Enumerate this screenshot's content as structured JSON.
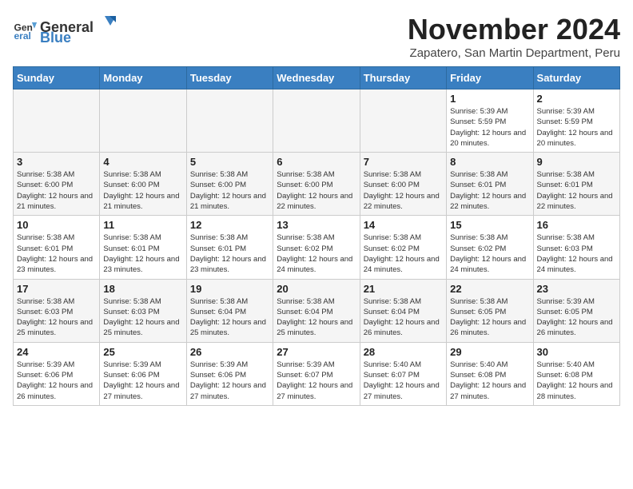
{
  "header": {
    "logo_general": "General",
    "logo_blue": "Blue",
    "month": "November 2024",
    "location": "Zapatero, San Martin Department, Peru"
  },
  "days_of_week": [
    "Sunday",
    "Monday",
    "Tuesday",
    "Wednesday",
    "Thursday",
    "Friday",
    "Saturday"
  ],
  "weeks": [
    [
      {
        "day": "",
        "info": ""
      },
      {
        "day": "",
        "info": ""
      },
      {
        "day": "",
        "info": ""
      },
      {
        "day": "",
        "info": ""
      },
      {
        "day": "",
        "info": ""
      },
      {
        "day": "1",
        "info": "Sunrise: 5:39 AM\nSunset: 5:59 PM\nDaylight: 12 hours and 20 minutes."
      },
      {
        "day": "2",
        "info": "Sunrise: 5:39 AM\nSunset: 5:59 PM\nDaylight: 12 hours and 20 minutes."
      }
    ],
    [
      {
        "day": "3",
        "info": "Sunrise: 5:38 AM\nSunset: 6:00 PM\nDaylight: 12 hours and 21 minutes."
      },
      {
        "day": "4",
        "info": "Sunrise: 5:38 AM\nSunset: 6:00 PM\nDaylight: 12 hours and 21 minutes."
      },
      {
        "day": "5",
        "info": "Sunrise: 5:38 AM\nSunset: 6:00 PM\nDaylight: 12 hours and 21 minutes."
      },
      {
        "day": "6",
        "info": "Sunrise: 5:38 AM\nSunset: 6:00 PM\nDaylight: 12 hours and 22 minutes."
      },
      {
        "day": "7",
        "info": "Sunrise: 5:38 AM\nSunset: 6:00 PM\nDaylight: 12 hours and 22 minutes."
      },
      {
        "day": "8",
        "info": "Sunrise: 5:38 AM\nSunset: 6:01 PM\nDaylight: 12 hours and 22 minutes."
      },
      {
        "day": "9",
        "info": "Sunrise: 5:38 AM\nSunset: 6:01 PM\nDaylight: 12 hours and 22 minutes."
      }
    ],
    [
      {
        "day": "10",
        "info": "Sunrise: 5:38 AM\nSunset: 6:01 PM\nDaylight: 12 hours and 23 minutes."
      },
      {
        "day": "11",
        "info": "Sunrise: 5:38 AM\nSunset: 6:01 PM\nDaylight: 12 hours and 23 minutes."
      },
      {
        "day": "12",
        "info": "Sunrise: 5:38 AM\nSunset: 6:01 PM\nDaylight: 12 hours and 23 minutes."
      },
      {
        "day": "13",
        "info": "Sunrise: 5:38 AM\nSunset: 6:02 PM\nDaylight: 12 hours and 24 minutes."
      },
      {
        "day": "14",
        "info": "Sunrise: 5:38 AM\nSunset: 6:02 PM\nDaylight: 12 hours and 24 minutes."
      },
      {
        "day": "15",
        "info": "Sunrise: 5:38 AM\nSunset: 6:02 PM\nDaylight: 12 hours and 24 minutes."
      },
      {
        "day": "16",
        "info": "Sunrise: 5:38 AM\nSunset: 6:03 PM\nDaylight: 12 hours and 24 minutes."
      }
    ],
    [
      {
        "day": "17",
        "info": "Sunrise: 5:38 AM\nSunset: 6:03 PM\nDaylight: 12 hours and 25 minutes."
      },
      {
        "day": "18",
        "info": "Sunrise: 5:38 AM\nSunset: 6:03 PM\nDaylight: 12 hours and 25 minutes."
      },
      {
        "day": "19",
        "info": "Sunrise: 5:38 AM\nSunset: 6:04 PM\nDaylight: 12 hours and 25 minutes."
      },
      {
        "day": "20",
        "info": "Sunrise: 5:38 AM\nSunset: 6:04 PM\nDaylight: 12 hours and 25 minutes."
      },
      {
        "day": "21",
        "info": "Sunrise: 5:38 AM\nSunset: 6:04 PM\nDaylight: 12 hours and 26 minutes."
      },
      {
        "day": "22",
        "info": "Sunrise: 5:38 AM\nSunset: 6:05 PM\nDaylight: 12 hours and 26 minutes."
      },
      {
        "day": "23",
        "info": "Sunrise: 5:39 AM\nSunset: 6:05 PM\nDaylight: 12 hours and 26 minutes."
      }
    ],
    [
      {
        "day": "24",
        "info": "Sunrise: 5:39 AM\nSunset: 6:06 PM\nDaylight: 12 hours and 26 minutes."
      },
      {
        "day": "25",
        "info": "Sunrise: 5:39 AM\nSunset: 6:06 PM\nDaylight: 12 hours and 27 minutes."
      },
      {
        "day": "26",
        "info": "Sunrise: 5:39 AM\nSunset: 6:06 PM\nDaylight: 12 hours and 27 minutes."
      },
      {
        "day": "27",
        "info": "Sunrise: 5:39 AM\nSunset: 6:07 PM\nDaylight: 12 hours and 27 minutes."
      },
      {
        "day": "28",
        "info": "Sunrise: 5:40 AM\nSunset: 6:07 PM\nDaylight: 12 hours and 27 minutes."
      },
      {
        "day": "29",
        "info": "Sunrise: 5:40 AM\nSunset: 6:08 PM\nDaylight: 12 hours and 27 minutes."
      },
      {
        "day": "30",
        "info": "Sunrise: 5:40 AM\nSunset: 6:08 PM\nDaylight: 12 hours and 28 minutes."
      }
    ]
  ]
}
